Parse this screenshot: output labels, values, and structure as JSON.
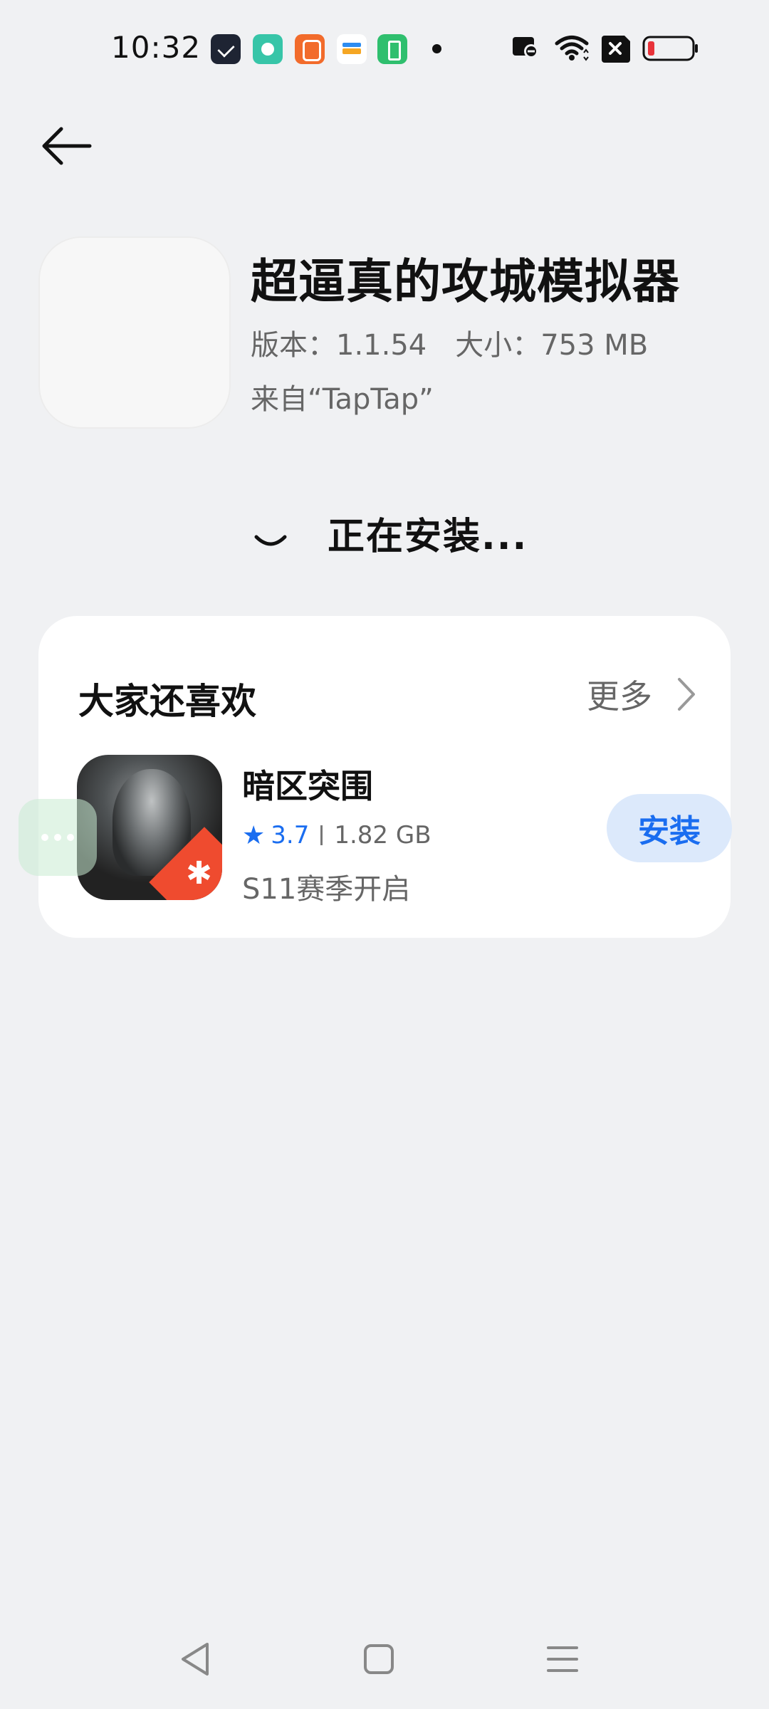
{
  "status_bar": {
    "time": "10:32",
    "notification_icons": [
      "mail-app-icon",
      "chat-app-icon",
      "video-app-icon",
      "wallet-app-icon",
      "battery-app-icon"
    ],
    "system_icons": [
      "nfc-icon",
      "wifi-icon",
      "no-sim-icon",
      "battery-low-icon"
    ],
    "battery_level": 0.1,
    "battery_color": "#e8333a"
  },
  "header": {
    "back_icon": "arrow-left-icon"
  },
  "app": {
    "title": "超逼真的攻城模拟器",
    "version": "版本：1.1.54",
    "size": "大小：753 MB",
    "source": "来自“TapTap”"
  },
  "install_status": {
    "text": "正在安装..."
  },
  "recommendations": {
    "title": "大家还喜欢",
    "more_label": "更多",
    "items": [
      {
        "name": "暗区突围",
        "rating": "3.7",
        "size": "1.82 GB",
        "description": "S11赛季开启",
        "button_label": "安装"
      }
    ]
  },
  "colors": {
    "accent": "#1a6df0",
    "install_button_bg": "#dce9fb",
    "background": "#f0f1f3"
  },
  "nav_bar": {
    "buttons": [
      "back-triangle-icon",
      "home-square-icon",
      "menu-lines-icon"
    ]
  }
}
